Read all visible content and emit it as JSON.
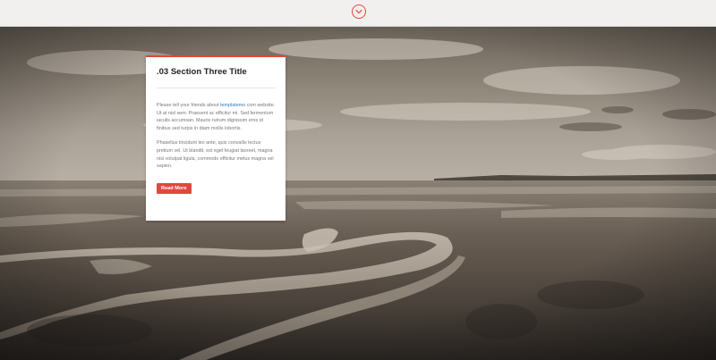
{
  "topbar": {
    "scroll_icon": "chevron-down-circle-icon",
    "accent_color": "#e2473f"
  },
  "section": {
    "title": ".03 Section Three Title",
    "paragraph1": {
      "before_link": "Please tell your friends about ",
      "link_text": "templatemo",
      "after_link": " com website. Ut at nisl sem. Praesent ac efficitur mi. Sed fermentum iaculis accumsan. Mauris rutrum dignissim eros id finibus sed turpis in diam mollis lobortis."
    },
    "paragraph2": "Phasellus tincidunt leo ante, quis convallis lectus pretium vel. Ut blandit, est eget feugiat laoreet, magna nisi volutpat ligula, commodo efficitur metus magna vel sapien.",
    "read_more_label": "Read More"
  }
}
